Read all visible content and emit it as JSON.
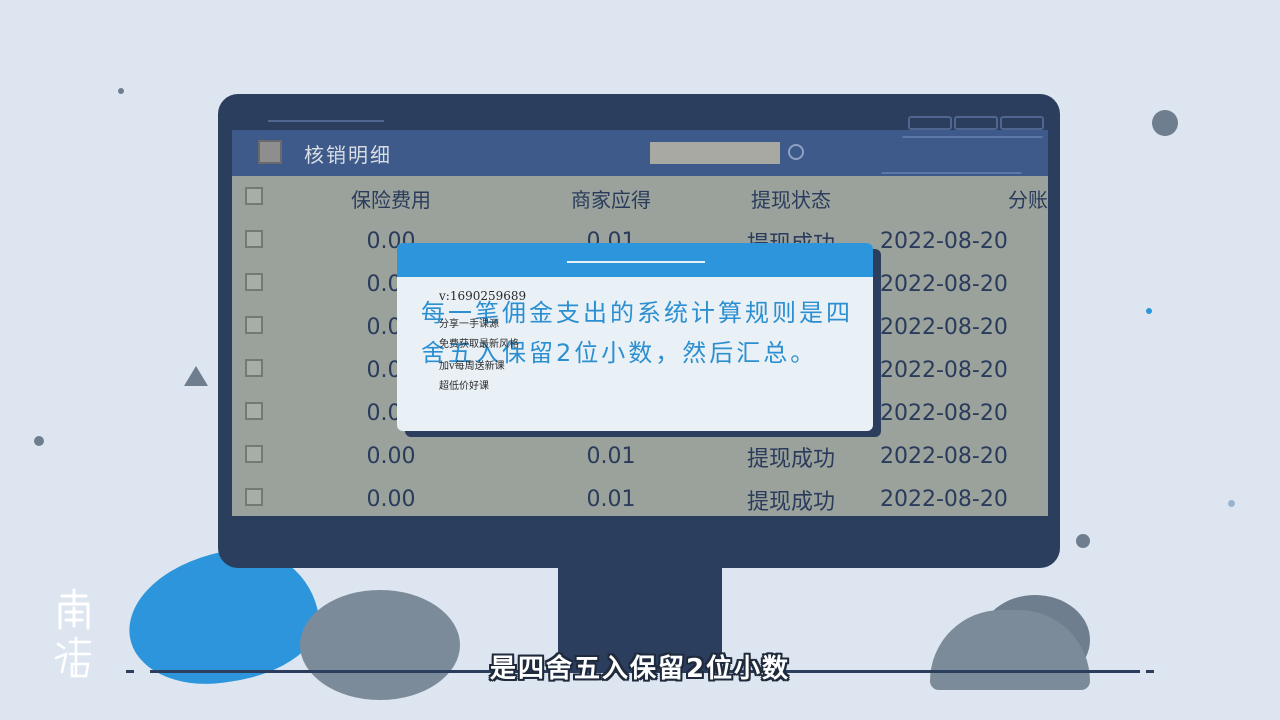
{
  "app": {
    "title": "核销明细"
  },
  "table": {
    "columns": [
      "保险费用",
      "商家应得",
      "提现状态",
      "分账"
    ],
    "rows": [
      {
        "insurance": "0.00",
        "merchant": "0.01",
        "status": "提现成功",
        "date": "2022-08-20"
      },
      {
        "insurance": "0.00",
        "merchant": "",
        "status": "",
        "date": "2022-08-20"
      },
      {
        "insurance": "0.00",
        "merchant": "",
        "status": "",
        "date": "2022-08-20"
      },
      {
        "insurance": "0.00",
        "merchant": "",
        "status": "",
        "date": "2022-08-20"
      },
      {
        "insurance": "0.00",
        "merchant": "",
        "status": "",
        "date": "2022-08-20"
      },
      {
        "insurance": "0.00",
        "merchant": "0.01",
        "status": "提现成功",
        "date": "2022-08-20"
      },
      {
        "insurance": "0.00",
        "merchant": "0.01",
        "status": "提现成功",
        "date": "2022-08-20"
      }
    ]
  },
  "modal": {
    "text": "每一笔佣金支出的系统计算规则是四舍五入保留2位小数，然后汇总。"
  },
  "watermark": {
    "line1": "v:1690259689",
    "line2": "分享一手课源",
    "line3": "免费获取最新风格",
    "line4": "加v每周送新课",
    "line5": "超低价好课"
  },
  "subtitle": "是四舍五入保留2位小数",
  "colors": {
    "background": "#dde6f0",
    "monitor": "#2c3e5e",
    "accent_blue": "#2c95dc",
    "modal_bg": "#e9f1f7"
  }
}
